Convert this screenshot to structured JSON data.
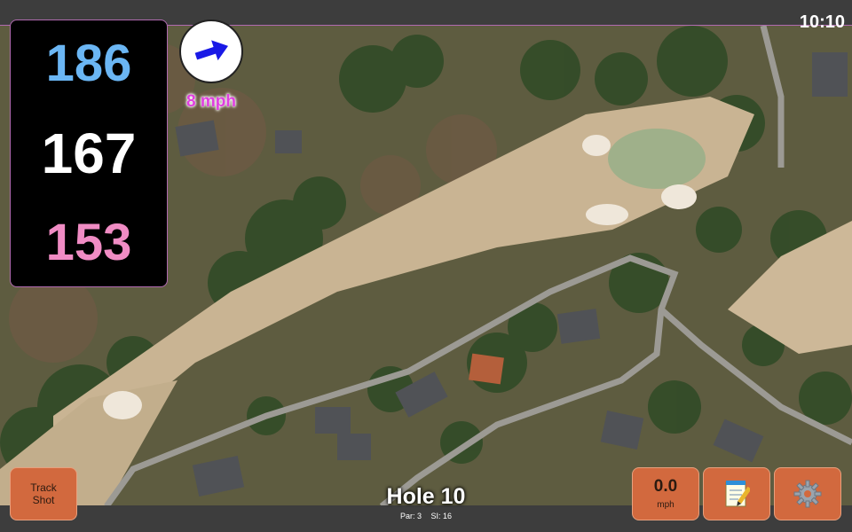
{
  "status": {
    "clock": "10:10"
  },
  "distances": {
    "back": "186",
    "middle": "167",
    "front": "153"
  },
  "wind": {
    "speed": "8 mph",
    "direction_icon": "wind-arrow-icon"
  },
  "hole": {
    "title": "Hole 10",
    "par": "Par: 3",
    "si": "SI: 16"
  },
  "buttons": {
    "track_shot_line1": "Track",
    "track_shot_line2": "Shot",
    "speed_value": "0.0",
    "speed_unit": "mph",
    "notes_icon": "notepad-icon",
    "settings_icon": "gear-icon"
  },
  "colors": {
    "back_distance": "#6bb6f4",
    "middle_distance": "#ffffff",
    "front_distance": "#f08cc4",
    "button": "#d2693e",
    "wind_text": "#e03fe0"
  }
}
